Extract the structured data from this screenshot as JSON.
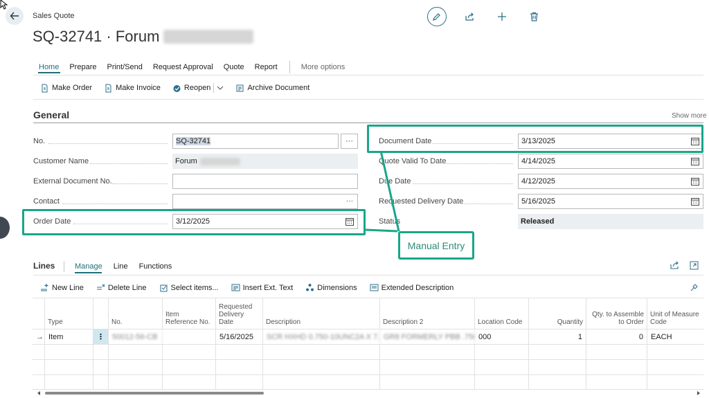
{
  "header": {
    "breadcrumb": "Sales Quote",
    "title_prefix": "SQ-32741 · Forum"
  },
  "menu": {
    "items": [
      "Home",
      "Prepare",
      "Print/Send",
      "Request Approval",
      "Quote",
      "Report"
    ],
    "more": "More options"
  },
  "actions": {
    "make_order": "Make Order",
    "make_invoice": "Make Invoice",
    "reopen": "Reopen",
    "archive": "Archive Document"
  },
  "general": {
    "title": "General",
    "show_more": "Show more",
    "no_label": "No.",
    "no_value": "SQ-32741",
    "customer_label": "Customer Name",
    "customer_value": "Forum",
    "extdoc_label": "External Document No.",
    "extdoc_value": "",
    "contact_label": "Contact",
    "contact_value": "",
    "order_date_label": "Order Date",
    "order_date_value": "3/12/2025",
    "doc_date_label": "Document Date",
    "doc_date_value": "3/13/2025",
    "valid_label": "Quote Valid To Date",
    "valid_value": "4/14/2025",
    "due_label": "Due Date",
    "due_value": "4/12/2025",
    "req_label": "Requested Delivery Date",
    "req_value": "5/16/2025",
    "status_label": "Status",
    "status_value": "Released"
  },
  "callout": {
    "text": "Manual Entry"
  },
  "lines": {
    "title": "Lines",
    "tabs": [
      "Manage",
      "Line",
      "Functions"
    ],
    "actions": {
      "new_line": "New Line",
      "delete_line": "Delete Line",
      "select_items": "Select items...",
      "insert_ext": "Insert Ext. Text",
      "dimensions": "Dimensions",
      "ext_desc": "Extended Description"
    },
    "columns": {
      "type": "Type",
      "no": "No.",
      "item_ref": "Item Reference No.",
      "req_date": "Requested Delivery Date",
      "description": "Description",
      "description2": "Description 2",
      "location": "Location Code",
      "quantity": "Quantity",
      "qty_assemble": "Qty. to Assemble to Order",
      "uom": "Unit of Measure Code"
    },
    "row": {
      "type": "Item",
      "no": "50012-56-CB",
      "req_date": "5/16/2025",
      "description": "SCR HXHD 0.750-10UNC2A X 7.",
      "description2": "GR8 FORMERLY PBB .750 ...",
      "location": "000",
      "quantity": "1",
      "qty_assemble": "0",
      "uom": "EACH"
    }
  }
}
